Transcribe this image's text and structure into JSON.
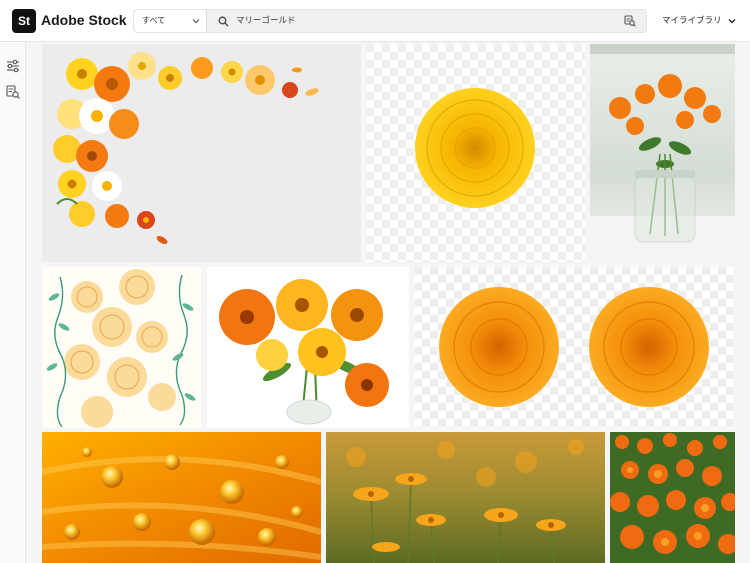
{
  "app": {
    "logo": "St",
    "name": "Adobe Stock"
  },
  "search": {
    "scope_label": "すべて",
    "query": "マリーゴールド",
    "search_icon": "search-icon",
    "visual_search_icon": "visual-search-icon"
  },
  "header": {
    "library_label": "マイライブラリ",
    "library_icon": "chevron-down-icon"
  },
  "sidebar": {
    "items": [
      {
        "icon": "filter-sliders-icon"
      },
      {
        "icon": "visual-search-icon"
      }
    ]
  },
  "results": [
    {
      "name": "flower-frame-photo"
    },
    {
      "name": "single-yellow-marigold-cutout"
    },
    {
      "name": "marigolds-in-jar-photo"
    },
    {
      "name": "marigold-pattern-illustration"
    },
    {
      "name": "calendula-bouquet-photo"
    },
    {
      "name": "two-orange-marigolds-cutout"
    },
    {
      "name": "orange-petals-water-drops-macro"
    },
    {
      "name": "calendula-field-photo"
    },
    {
      "name": "marigold-field-photo"
    }
  ],
  "colors": {
    "accent": "#f5a000",
    "orange": "#f07a12",
    "yellow": "#f7c81c",
    "topbar": "#ffffff"
  }
}
